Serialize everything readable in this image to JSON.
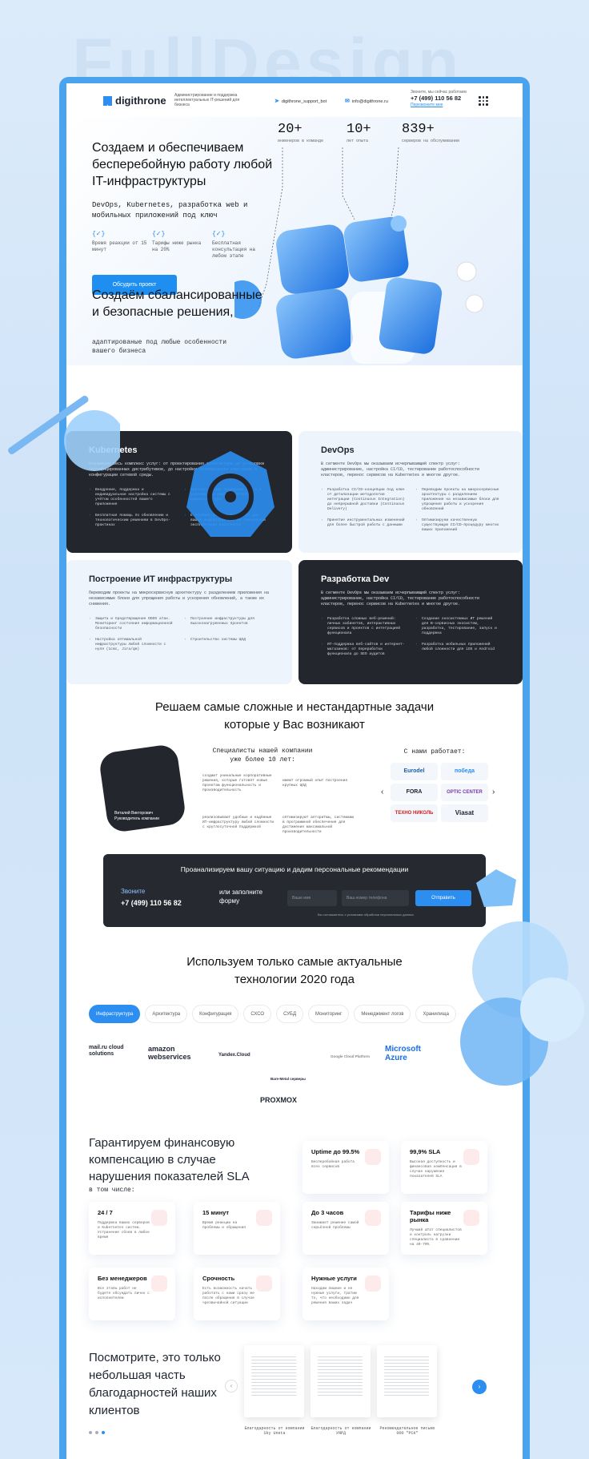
{
  "bg_word": "FullDesign",
  "header": {
    "logo": "digithrone",
    "tagline": "Администрирование и поддержка интеллектуальных IT-решений для бизнеса",
    "telegram": "digithrone_support_bot",
    "email": "info@digithrone.ru",
    "phone_note": "Звоните, мы сейчас работаем",
    "phone": "+7 (499) 110 56 82",
    "callback": "Перезвоните мне"
  },
  "hero": {
    "title": "Создаем и обеспечиваем бесперебойную работу любой IT-инфраструктуры",
    "subtitle": "DevOps, Kubernetes, разработка web и мобильных приложений под ключ",
    "features": [
      "Время реакции от 15 минут",
      "Тарифы ниже рынка на 20%",
      "Бесплатная консультация на любом этапе"
    ],
    "button": "Обсудить проект",
    "stats": [
      {
        "value": "20+",
        "label": "инженеров в команде"
      },
      {
        "value": "10+",
        "label": "лет опыта"
      },
      {
        "value": "839+",
        "label": "серверов на обслуживании"
      }
    ]
  },
  "section2": {
    "title": "Создаём сбалансированные и безопасные решения,",
    "subtitle": "адаптированые под любые особенности вашего бизнеса"
  },
  "cards": [
    {
      "title": "Kubernetes",
      "text": "Оказываем весь комплекс услуг: от проектирования архитектуры до установки сертифицированных дистрибутивов, до настройки безопасности кластеров и конфигурации сетевой среды.",
      "bullets": [
        "Внедрение, поддержка и индивидуальная настройка системы с учётом особенностей вашего приложения",
        "Круглосуточная поддержка с 1 и 2 уровнем для вашей Kubernetes-инфраструктуры",
        "Бесплатная помощь по обновлению и технологическим решениям в DevOps-практиках",
        "Е-учебный обучающий тренинг для вашей инфраструктуры по правильной эксплуатации Kubernetes"
      ]
    },
    {
      "title": "DevOps",
      "text": "В сегменте DevOps мы оказываем исчерпывающий спектр услуг: администрирование, настройка CI/CD, тестирование работоспособности кластеров, перенос сервисов на Kubernetes и многое другое.",
      "bullets": [
        "Разработка CI/CD-концепции под ключ от детализации методологии интеграции (Continuous Integration) до непрерывной доставки (Continuous Delivery)",
        "Переводим проекты на микросервисные архитектуры с разделением приложения на независимые блоки для упрощения работы и ускорения обновлений",
        "Принятие инструментальных изменений для более быстрой работы с данными",
        "Оптимизируем качественную существующую CI/CD-процедуру многих ваших приложений"
      ]
    },
    {
      "title": "Построение ИТ инфраструктуры",
      "text": "Переводим проекты на микросервисную архитектуру с разделением приложения на независимые блоки для упрощения работы и ускорения обновлений, а также их снижения.",
      "bullets": [
        "Защита и предотвращение DDOS атак. Мониторинг состояния информационной безопасности",
        "Построение инфраструктуры для высоконагруженных проектов",
        "Настройка оптимальной инфраструктуры любой сложности с нуля (1cmc, Jira/qm)",
        "Строительство системы ЦОД"
      ]
    },
    {
      "title": "Разработка Dev",
      "text": "В сегменте DevOps мы оказываем исчерпывающий спектр услуг: администрирование, настройка CI/CD, тестирование работоспособности кластеров, перенос сервисов на Kubernetes и многое другое.",
      "bullets": [
        "Разработка сложных веб-решений: личных кабинетов, интерактивных сервисов и проектов с интеграцией функционала",
        "Создание экосистемных ИТ решений для В-сервисных экосистем, разработка, тестирование, запуск и поддержка",
        "ИТ-поддержка веб-сайтов и интернет-магазинов: от переработки функционала до SEO аудитов",
        "Разработка мобильных приложений любой сложности для iOS и Android"
      ]
    }
  ],
  "section3": {
    "title": "Решаем самые сложные и нестандартные задачи которые у Вас возникают",
    "person_name": "Виталий Викторович",
    "person_role": "Руководитель компании",
    "specialists": "Специалисты нашей компании уже более 10 лет:",
    "points": [
      "создают уникальные корпоративные решения, которые готовят новые проектам функциональность и производительность",
      "имеют огромный опыт построения крупных ЦОД",
      "реализовывают удобные и надёжные ИТ-инфраструктуру любой сложности с круглосуточной поддержкой",
      "оптимизируют алгоритмы, системами в программной обеспечения для достижения максимальной производительности"
    ],
    "partners_title": "С нами работает:",
    "partners": [
      "Eurodel",
      "победа",
      "FORA",
      "OPTIC CENTER",
      "ТЕХНО НИКОЛЬ",
      "Viasat"
    ]
  },
  "cta": {
    "title": "Проанализируем вашу ситуацию и дадим персональные рекомендации",
    "call": "Звоните",
    "phone": "+7 (499) 110 56 82",
    "or": "или заполните форму",
    "name_ph": "Ваше имя",
    "phone_ph": "Ваш номер телефона",
    "button": "Отправить",
    "consent": "Вы соглашаетесь с условиями обработки персональных данных"
  },
  "tech": {
    "title": "Используем только самые актуальные технологии 2020 года",
    "tabs": [
      "Инфраструктура",
      "Архитектура",
      "Конфигурация",
      "СХСО",
      "СУБД",
      "Мониторинг",
      "Менеджмент логов",
      "Хранилища"
    ],
    "logos": [
      "mail.ru cloud solutions",
      "amazon webservices",
      "Yandex.Cloud",
      "Bare-Metal серверы",
      "Google Cloud Platform",
      "Microsoft Azure",
      "PROXMOX"
    ]
  },
  "sla": {
    "title": "Гарантируем финансовую компенсацию в случае нарушения показателей SLA",
    "subtitle": "в том числе:",
    "boxes": [
      {
        "t": "Uptime до 99.5%",
        "d": "Бесперебойная работа всех сервисов"
      },
      {
        "t": "99,9% SLA",
        "d": "Высокая доступность и финансовая компенсация в случае нарушения показателей SLA"
      },
      {
        "t": "24 / 7",
        "d": "Поддержка ваших серверов и Kubernetes систем. Устранение сбоев в любое время"
      },
      {
        "t": "15 минут",
        "d": "Время реакции на проблемы и обращения"
      },
      {
        "t": "До 3 часов",
        "d": "Занимает решение самой серьёзной проблемы"
      },
      {
        "t": "Тарифы ниже рынка",
        "d": "Лучший штат специалистов и контроль нагрузки специалиста в сравнении на 40-70%"
      },
      {
        "t": "Без менеджеров",
        "d": "Все этапы работ не будете обсуждать лично с исполнителем"
      },
      {
        "t": "Срочность",
        "d": "Есть возможность начать работать с нами сразу же после обращения в случае чрезвычайной ситуации"
      },
      {
        "t": "Нужные услуги",
        "d": "Находим лишние и не нужные услуги, тратим то, что необходимо для решения ваших задач"
      }
    ]
  },
  "thanks": {
    "title": "Посмотрите, это только небольшая часть благодарностей наших клиентов",
    "captions": [
      "Благодарность от компании Sky Uneta",
      "Благодарность от компании УЯРД",
      "Рекомендательное письмо ООО \"РСК\""
    ]
  },
  "colors": {
    "accent": "#2b8ef0",
    "dark": "#23262d",
    "light": "#eef4fb"
  }
}
